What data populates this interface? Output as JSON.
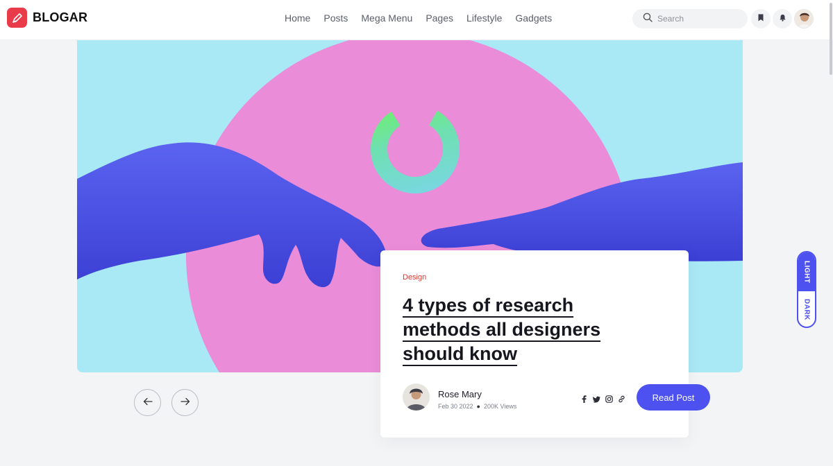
{
  "header": {
    "logo_text": "BLOGAR",
    "nav": [
      "Home",
      "Posts",
      "Mega Menu",
      "Pages",
      "Lifestyle",
      "Gadgets"
    ],
    "search_placeholder": "Search",
    "icons": [
      "search-icon",
      "bookmark-icon",
      "bell-icon",
      "avatar"
    ]
  },
  "post": {
    "category": "Design",
    "title_lines": [
      "4 types of research",
      "methods all designers",
      "should know"
    ],
    "author": "Rose Mary",
    "date": "Feb 30 2022",
    "views": "200K Views",
    "socials": [
      "facebook-icon",
      "twitter-icon",
      "instagram-icon",
      "link-icon"
    ],
    "read_button": "Read Post"
  },
  "theme_switch": {
    "light": "LIGHT",
    "dark": "DARK"
  },
  "colors": {
    "accent": "#4c51f0",
    "brand": "#ea3b4b",
    "category": "#d9352f",
    "hero_bg": "#a9e8f5",
    "hero_circle": "#ea8cd8"
  }
}
